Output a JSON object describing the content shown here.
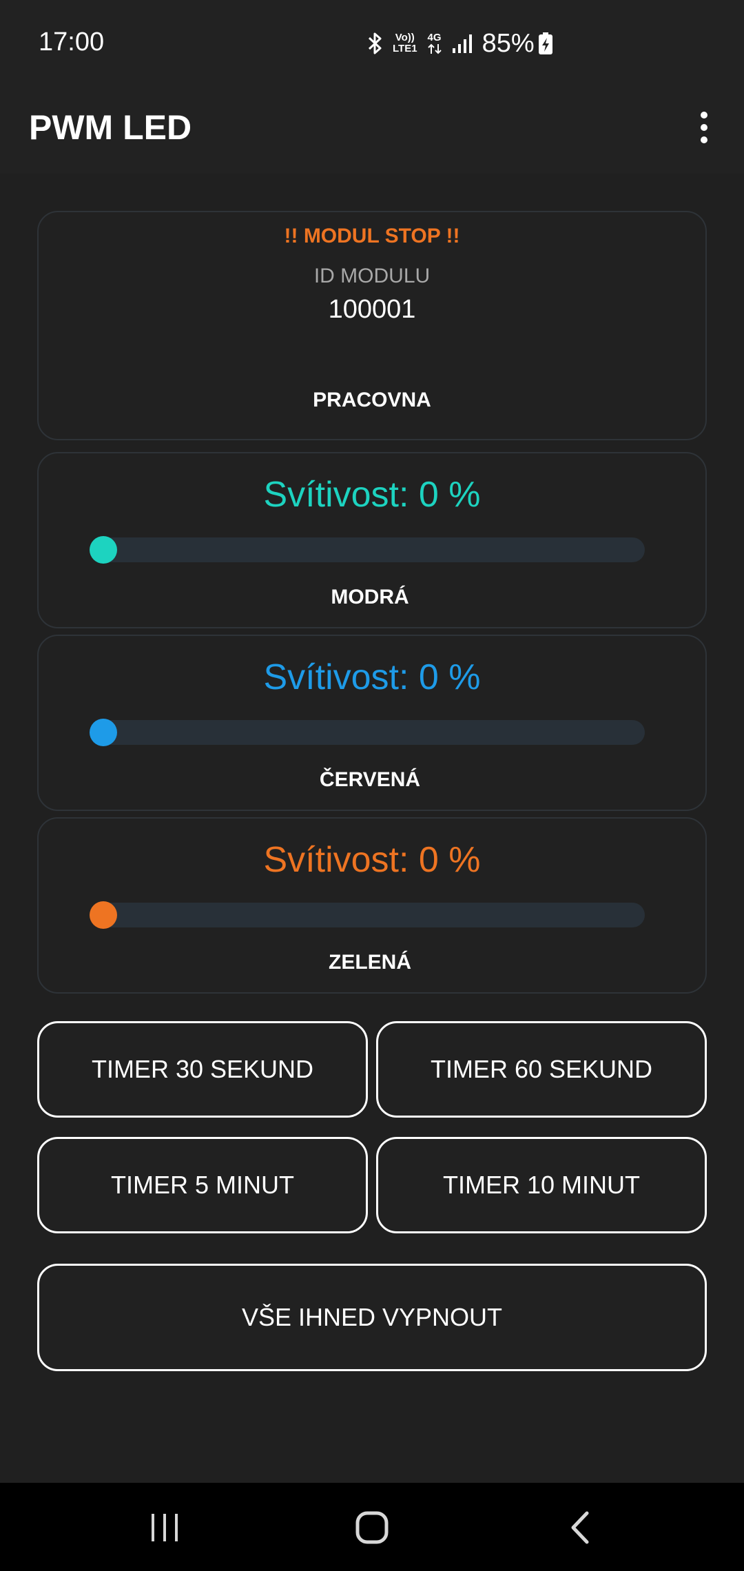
{
  "status_bar": {
    "time": "17:00",
    "network_top": "Vo))",
    "network_bottom": "LTE1",
    "data_type": "4G",
    "battery_percent": "85%",
    "icons": [
      "bluetooth-icon",
      "volte-icon",
      "4g-data-icon",
      "signal-icon",
      "battery-charging-icon"
    ]
  },
  "app_bar": {
    "title": "PWM LED",
    "menu_icon": "more-vert-icon"
  },
  "module_card": {
    "status": "!! MODUL STOP !!",
    "status_color": "#EE7422",
    "id_label": "ID MODULU",
    "id_value": "100001",
    "name": "PRACOVNA"
  },
  "led_channels": [
    {
      "title": "Svítivost: 0 %",
      "label": "MODRÁ",
      "color": "#1DD3C0",
      "value_percent": 0
    },
    {
      "title": "Svítivost: 0 %",
      "label": "ČERVENÁ",
      "color": "#1E9BE8",
      "value_percent": 0
    },
    {
      "title": "Svítivost: 0 %",
      "label": "ZELENÁ",
      "color": "#EE7422",
      "value_percent": 0
    }
  ],
  "buttons": {
    "timer_30s": "TIMER 30 SEKUND",
    "timer_60s": "TIMER 60 SEKUND",
    "timer_5m": "TIMER 5 MINUT",
    "timer_10m": "TIMER 10 MINUT",
    "all_off": "VŠE IHNED VYPNOUT"
  },
  "nav_bar": {
    "icons": [
      "recent-apps-icon",
      "home-icon",
      "back-icon"
    ]
  }
}
